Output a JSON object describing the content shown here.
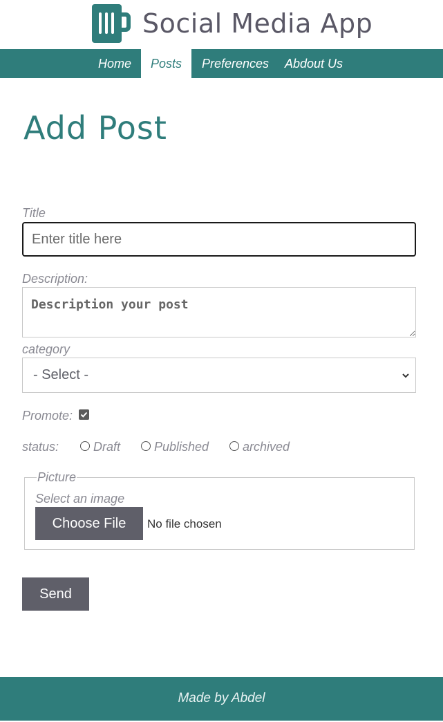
{
  "app": {
    "title": "Social Media App",
    "logo_icon": "coffee-mug-logo-icon"
  },
  "nav": {
    "items": [
      {
        "label": "Home"
      },
      {
        "label": "Posts",
        "active": true
      },
      {
        "label": "Preferences"
      },
      {
        "label": "Abdout Us"
      }
    ]
  },
  "page": {
    "heading": "Add Post"
  },
  "form": {
    "title_label": "Title",
    "title_placeholder": "Enter title here",
    "title_value": "",
    "description_label": "Description:",
    "description_placeholder": "Description your post",
    "description_value": "",
    "category_label": "category",
    "category_selected": "- Select -",
    "promote_label": "Promote:",
    "promote_checked": true,
    "status_label": "status:",
    "status_options": [
      "Draft",
      "Published",
      "archived"
    ],
    "picture_legend": "Picture",
    "image_label": "Select an image",
    "choose_file_label": "Choose File",
    "no_file_text": "No file chosen",
    "send_label": "Send"
  },
  "footer": {
    "text": "Made by Abdel"
  },
  "colors": {
    "brand_teal": "#2f7d7b",
    "button_gray": "#5f5f69",
    "text_gray": "#8a8a93"
  }
}
